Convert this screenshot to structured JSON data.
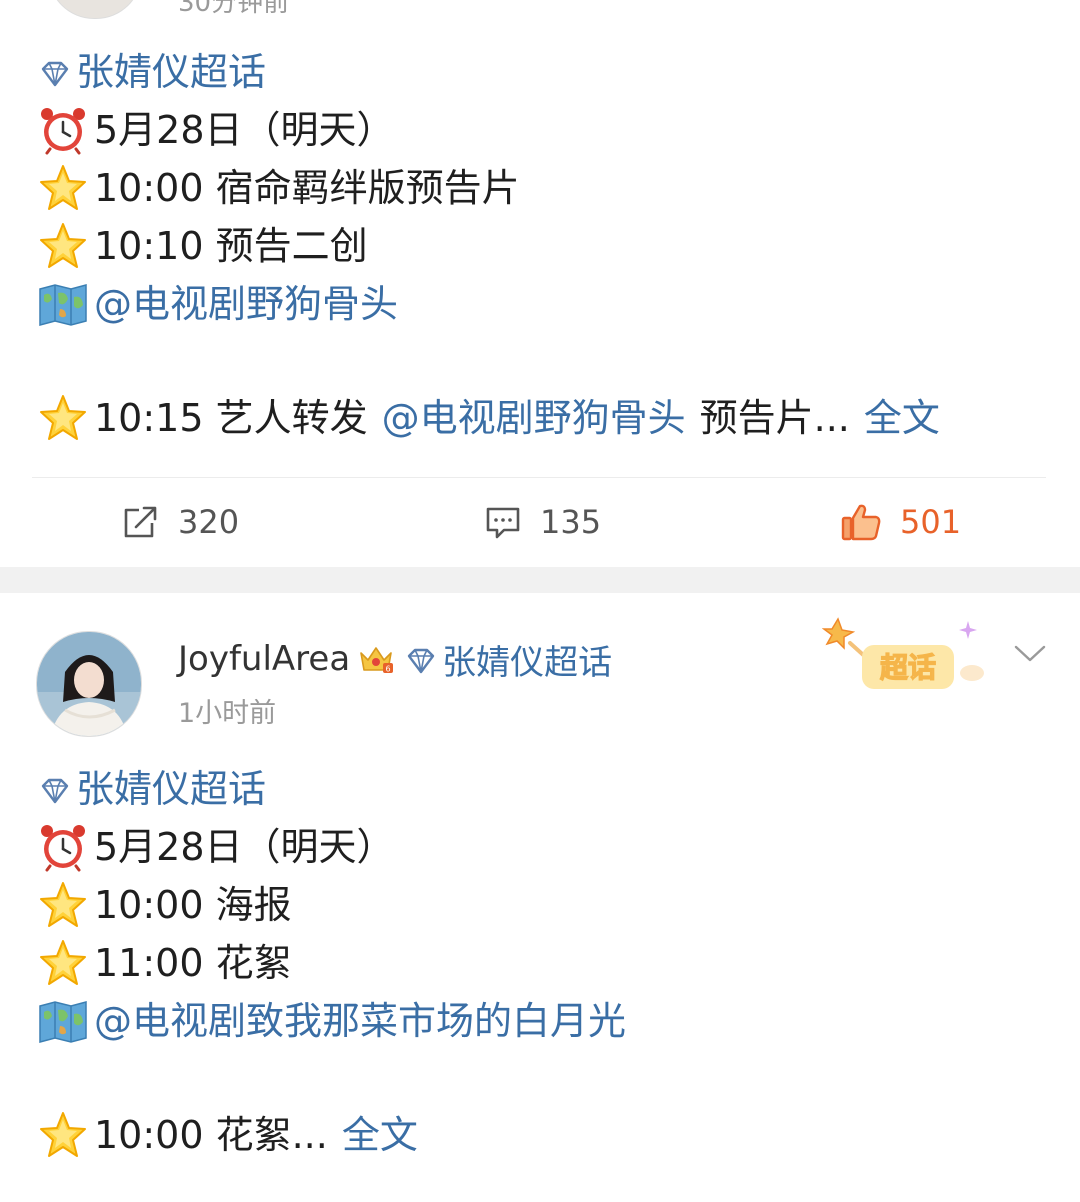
{
  "post1": {
    "time_partial": "30分钟前",
    "topic": "张婧仪超话",
    "lines": [
      {
        "icon": "alarm-clock-icon",
        "text": "5月28日（明天）"
      },
      {
        "icon": "star-icon",
        "text": "10:00 宿命羁绊版预告片"
      },
      {
        "icon": "star-icon",
        "text": "10:10 预告二创"
      },
      {
        "icon": "map-icon",
        "mention": "@电视剧野狗骨头"
      }
    ],
    "last_line": {
      "icon": "star-icon",
      "text_before": "10:15 艺人转发",
      "mention": "@电视剧野狗骨头",
      "text_after": "预告片...",
      "more_link": "全文"
    },
    "actions": {
      "repost_count": "320",
      "comment_count": "135",
      "like_count": "501"
    }
  },
  "post2": {
    "username": "JoyfulArea",
    "header_topic": "张婧仪超话",
    "time": "1小时前",
    "badge_text": "超话",
    "topic": "张婧仪超话",
    "lines": [
      {
        "icon": "alarm-clock-icon",
        "text": "5月28日（明天）"
      },
      {
        "icon": "star-icon",
        "text": "10:00 海报"
      },
      {
        "icon": "star-icon",
        "text": "11:00 花絮"
      },
      {
        "icon": "map-icon",
        "mention": "@电视剧致我那菜市场的白月光"
      }
    ],
    "last_line": {
      "icon": "star-icon",
      "text_before": "10:00 花絮...",
      "more_link": "全文"
    }
  },
  "colors": {
    "link": "#3a6ea5",
    "like": "#e8622a",
    "divider": "#f1f1f1"
  }
}
